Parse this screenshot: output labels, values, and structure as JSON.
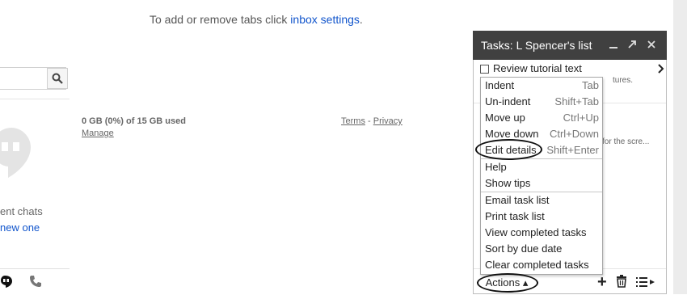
{
  "inbox_notice": {
    "prefix": "To add or remove tabs click ",
    "link": "inbox settings",
    "suffix": "."
  },
  "hangouts": {
    "no_chats_text": "ent chats",
    "new_one_link": "new one"
  },
  "storage": {
    "usage": "0 GB (0%) of 15 GB used",
    "manage": "Manage"
  },
  "footer": {
    "terms": "Terms",
    "separator": " - ",
    "privacy": "Privacy"
  },
  "tasks": {
    "title": "Tasks: L Spencer's list",
    "task_item": "Review tutorial text",
    "bg_note_1": "tures.",
    "bg_note_2": "for the scre...",
    "actions_label": "Actions ▴",
    "menu": [
      {
        "label": "Indent",
        "shortcut": "Tab"
      },
      {
        "label": "Un-indent",
        "shortcut": "Shift+Tab"
      },
      {
        "label": "Move up",
        "shortcut": "Ctrl+Up"
      },
      {
        "label": "Move down",
        "shortcut": "Ctrl+Down"
      },
      {
        "label": "Edit details",
        "shortcut": "Shift+Enter"
      },
      {
        "label": "Help",
        "shortcut": ""
      },
      {
        "label": "Show tips",
        "shortcut": ""
      },
      {
        "label": "Email task list",
        "shortcut": ""
      },
      {
        "label": "Print task list",
        "shortcut": ""
      },
      {
        "label": "View completed tasks",
        "shortcut": ""
      },
      {
        "label": "Sort by due date",
        "shortcut": ""
      },
      {
        "label": "Clear completed tasks",
        "shortcut": ""
      }
    ],
    "header_icons": [
      "minimize-icon",
      "popout-icon",
      "close-icon"
    ],
    "footer_icons": [
      "add-icon",
      "trash-icon",
      "list-menu-icon"
    ]
  },
  "colors": {
    "header_bg": "#404040",
    "link": "#1155cc"
  }
}
